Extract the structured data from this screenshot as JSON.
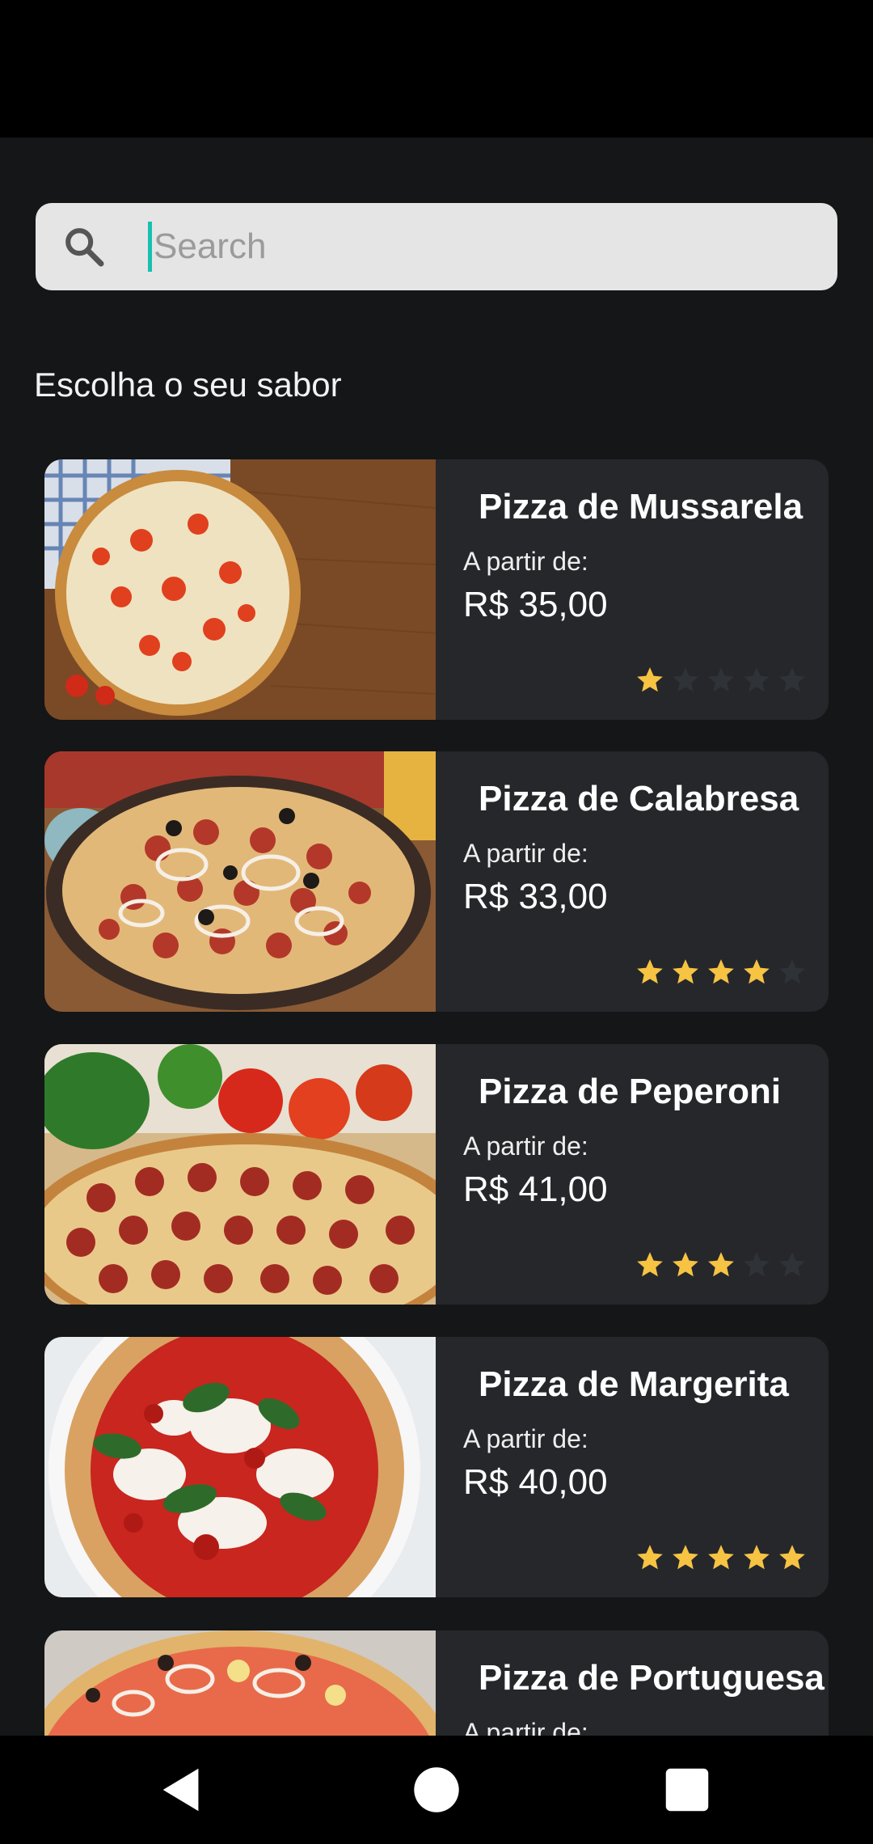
{
  "search": {
    "placeholder": "Search"
  },
  "section_title": "Escolha o seu sabor",
  "colors": {
    "star_on": "#f6c343",
    "star_off": "#2f3236",
    "accent_caret": "#17c0b0"
  },
  "pizzas": [
    {
      "name": "Pizza de Mussarela",
      "from_label": "A partir de:",
      "price": "R$ 35,00",
      "rating": 1
    },
    {
      "name": "Pizza de Calabresa",
      "from_label": "A partir de:",
      "price": "R$ 33,00",
      "rating": 4
    },
    {
      "name": "Pizza de Peperoni",
      "from_label": "A partir de:",
      "price": "R$ 41,00",
      "rating": 3
    },
    {
      "name": "Pizza de Margerita",
      "from_label": "A partir de:",
      "price": "R$ 40,00",
      "rating": 5
    },
    {
      "name": "Pizza de Portuguesa",
      "from_label": "A partir de:",
      "price": "",
      "rating": 0
    }
  ],
  "nav": {
    "back": "back-icon",
    "home": "home-icon",
    "recents": "recents-icon"
  }
}
